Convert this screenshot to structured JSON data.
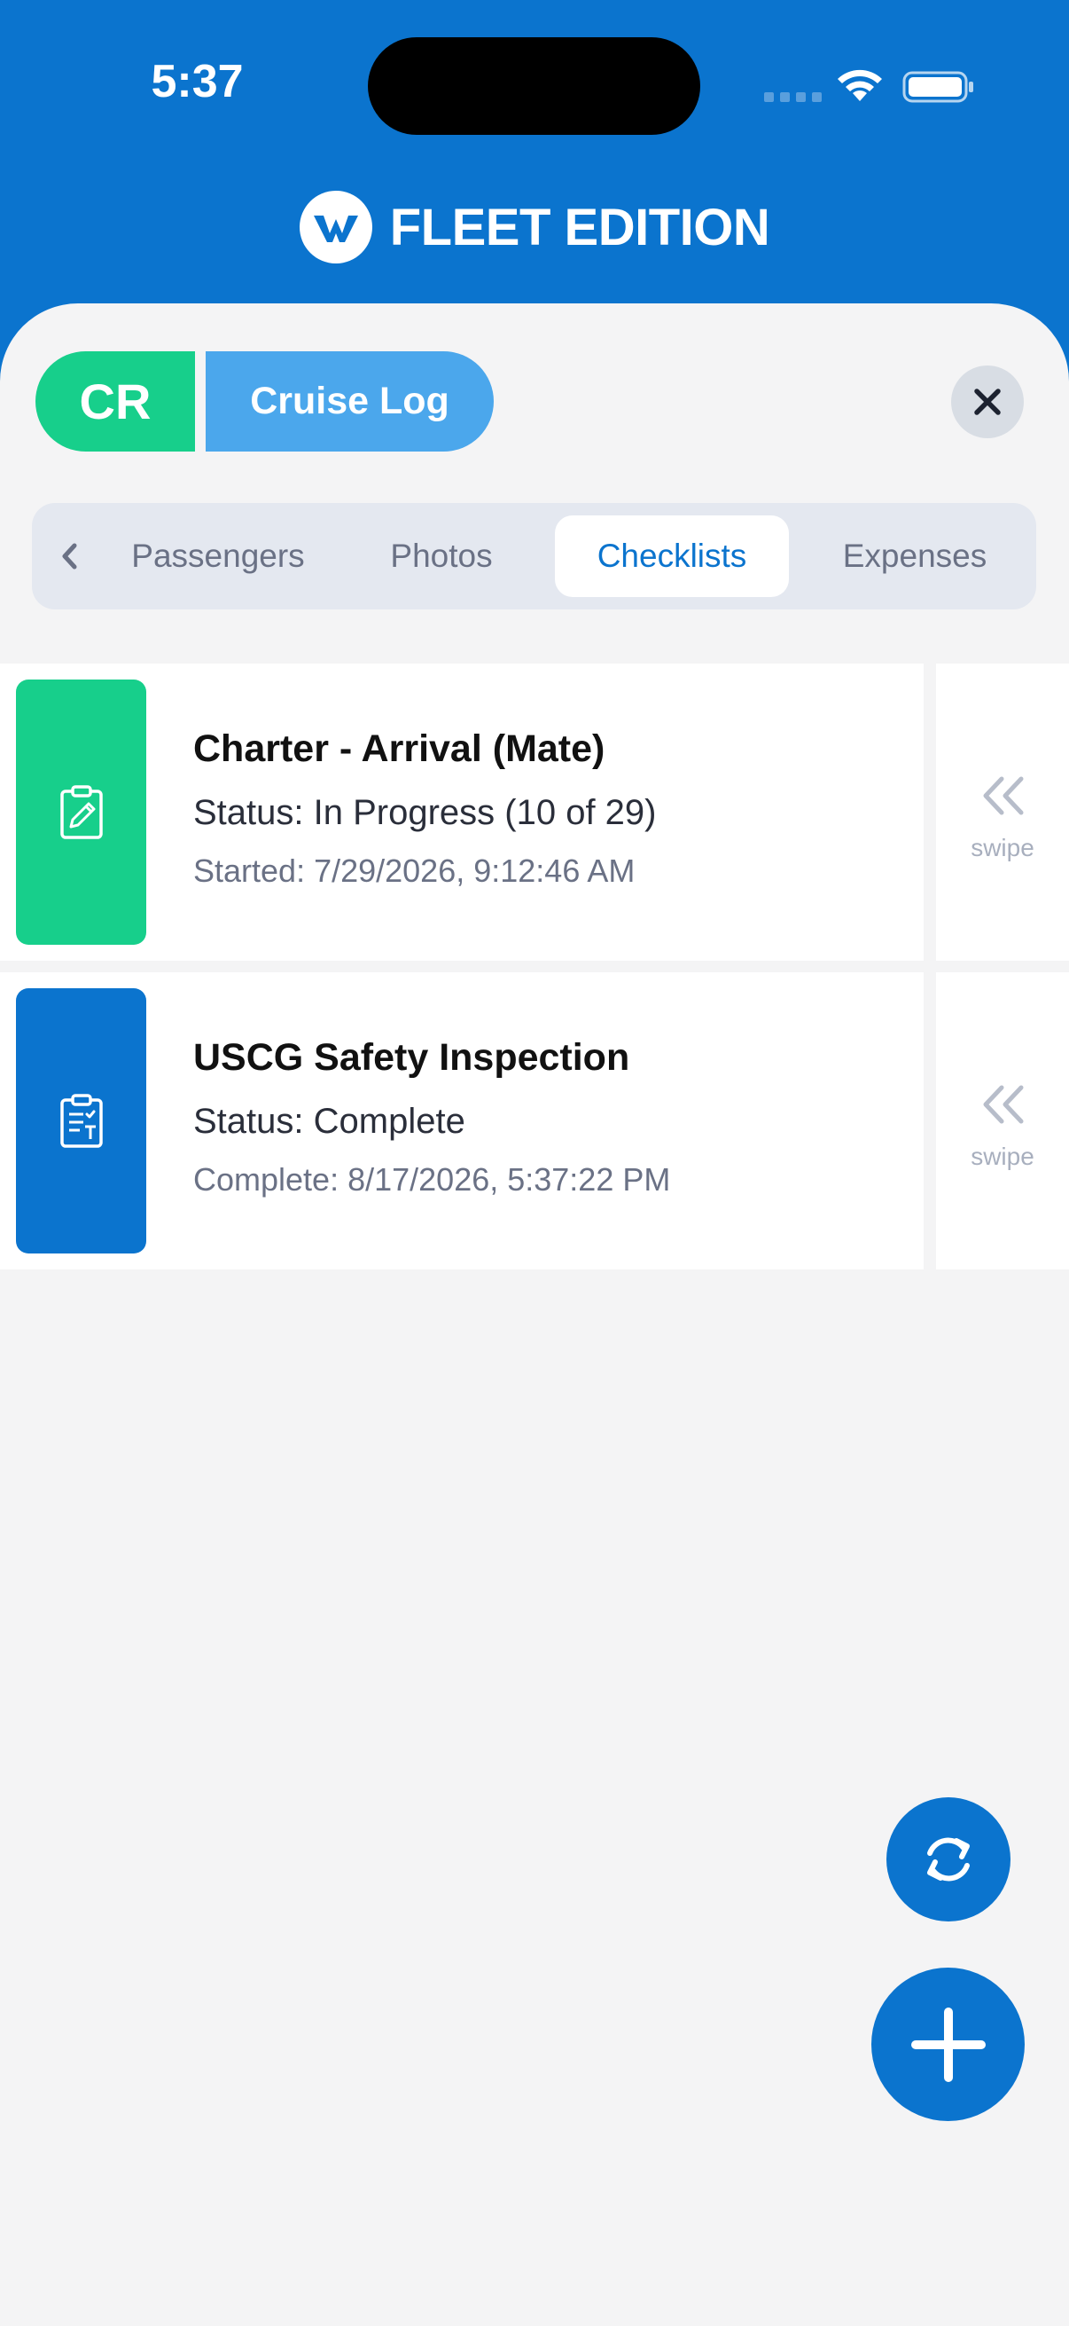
{
  "status_bar": {
    "time": "5:37"
  },
  "brand": {
    "name": "FLEET EDITION",
    "logo_icon": "fleet-logo-icon",
    "header_color": "#0B74CE"
  },
  "log": {
    "badge": "CR",
    "title": "Cruise Log",
    "badge_color": "#17CF8B",
    "title_color": "#4BA7EC"
  },
  "tabs": {
    "items": [
      {
        "label": "Passengers"
      },
      {
        "label": "Photos"
      },
      {
        "label": "Checklists",
        "active": true
      },
      {
        "label": "Expenses"
      }
    ]
  },
  "checklists": [
    {
      "title": "Charter - Arrival (Mate)",
      "status": "Status: In Progress (10 of 29)",
      "timestamp": "Started: 7/29/2026, 9:12:46 AM",
      "icon": "clipboard-edit-icon",
      "color": "#17CF8B",
      "swipe_hint": "swipe"
    },
    {
      "title": "USCG Safety Inspection",
      "status": "Status: Complete",
      "timestamp": "Complete: 8/17/2026, 5:37:22 PM",
      "icon": "clipboard-check-icon",
      "color": "#0B74CE",
      "swipe_hint": "swipe"
    }
  ]
}
